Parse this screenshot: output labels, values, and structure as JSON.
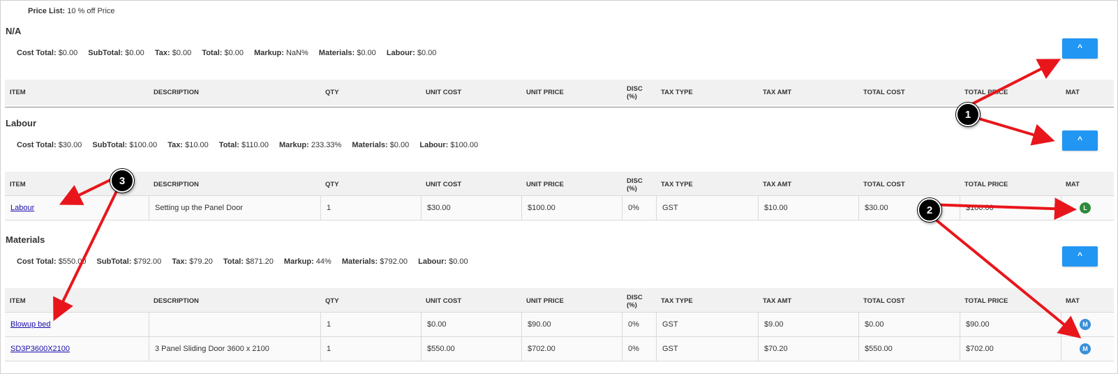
{
  "price_list": {
    "label": "Price List:",
    "value": "10 % off Price"
  },
  "columns": [
    "ITEM",
    "DESCRIPTION",
    "QTY",
    "UNIT COST",
    "UNIT PRICE",
    "DISC",
    "(%)",
    "TAX TYPE",
    "TAX AMT",
    "TOTAL COST",
    "TOTAL PRICE",
    "MAT"
  ],
  "collapse_label": "^",
  "totals_labels": {
    "cost": "Cost Total:",
    "sub": "SubTotal:",
    "tax": "Tax:",
    "total": "Total:",
    "markup": "Markup:",
    "materials": "Materials:",
    "labour": "Labour:"
  },
  "sections": [
    {
      "title": "N/A",
      "totals": {
        "cost": "$0.00",
        "sub": "$0.00",
        "tax": "$0.00",
        "total": "$0.00",
        "markup": "NaN%",
        "materials": "$0.00",
        "labour": "$0.00"
      }
    },
    {
      "title": "Labour",
      "totals": {
        "cost": "$30.00",
        "sub": "$100.00",
        "tax": "$10.00",
        "total": "$110.00",
        "markup": "233.33%",
        "materials": "$0.00",
        "labour": "$100.00"
      },
      "rows": [
        {
          "item": "Labour",
          "description": "Setting up the Panel Door",
          "qty": "1",
          "unit_cost": "$30.00",
          "unit_price": "$100.00",
          "disc": "0%",
          "tax_type": "GST",
          "tax_amt": "$10.00",
          "total_cost": "$30.00",
          "total_price": "$100.00",
          "mat": "L"
        }
      ]
    },
    {
      "title": "Materials",
      "totals": {
        "cost": "$550.00",
        "sub": "$792.00",
        "tax": "$79.20",
        "total": "$871.20",
        "markup": "44%",
        "materials": "$792.00",
        "labour": "$0.00"
      },
      "rows": [
        {
          "item": "Blowup bed",
          "description": "",
          "qty": "1",
          "unit_cost": "$0.00",
          "unit_price": "$90.00",
          "disc": "0%",
          "tax_type": "GST",
          "tax_amt": "$9.00",
          "total_cost": "$0.00",
          "total_price": "$90.00",
          "mat": "M"
        },
        {
          "item": "SD3P3600X2100",
          "description": "3 Panel Sliding Door 3600 x 2100",
          "qty": "1",
          "unit_cost": "$550.00",
          "unit_price": "$702.00",
          "disc": "0%",
          "tax_type": "GST",
          "tax_amt": "$70.20",
          "total_cost": "$550.00",
          "total_price": "$702.00",
          "mat": "M"
        }
      ]
    }
  ],
  "annotations": [
    "1",
    "2",
    "3"
  ],
  "colors": {
    "button": "#2196f3",
    "badge_labour": "#2e8b3d",
    "badge_material": "#3a8fd8",
    "arrow": "#e8161b"
  }
}
